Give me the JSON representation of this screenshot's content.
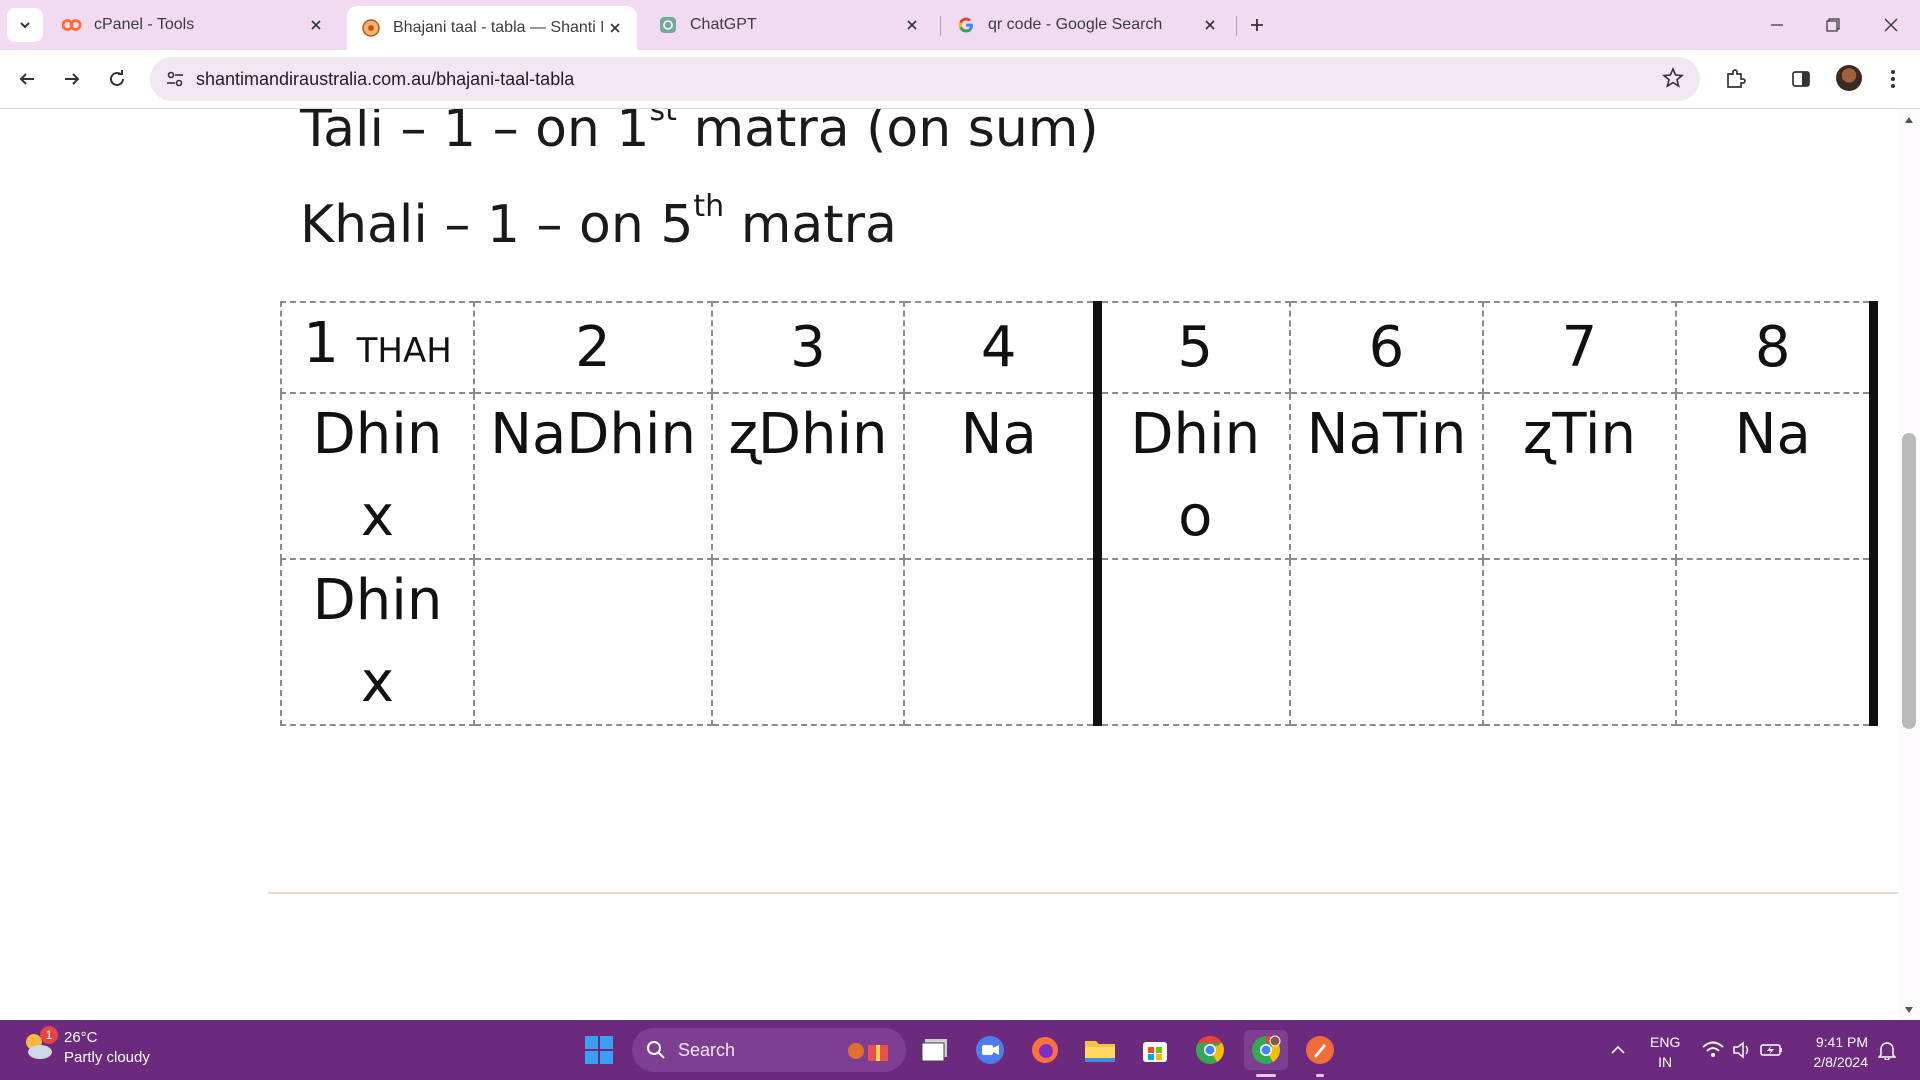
{
  "browser": {
    "tabs": [
      {
        "title": "cPanel - Tools",
        "active": false
      },
      {
        "title": "Bhajani taal - tabla — Shanti M",
        "active": true
      },
      {
        "title": "ChatGPT",
        "active": false
      },
      {
        "title": "qr code - Google Search",
        "active": false
      }
    ],
    "url": "shantimandiraustralia.com.au/bhajani-taal-tabla"
  },
  "page": {
    "tali_line": {
      "text": "Tali – 1 – on 1",
      "sup": "st",
      "rest": " matra (on sum)"
    },
    "khali_line": {
      "text": "Khali – 1 – on 5",
      "sup": "th",
      "rest": " matra"
    },
    "table": {
      "header": [
        {
          "num": "1",
          "extra": "THAH"
        },
        {
          "num": "2",
          "extra": ""
        },
        {
          "num": "3",
          "extra": ""
        },
        {
          "num": "4",
          "extra": ""
        },
        {
          "num": "5",
          "extra": ""
        },
        {
          "num": "6",
          "extra": ""
        },
        {
          "num": "7",
          "extra": ""
        },
        {
          "num": "8",
          "extra": ""
        }
      ],
      "row1": [
        "Dhin\nx",
        "NaDhin",
        "ʐDhin",
        "Na",
        "Dhin\no",
        "NaTin",
        "ʐTin",
        "Na"
      ],
      "row2": [
        "Dhin\nx",
        "",
        "",
        "",
        "",
        "",
        "",
        ""
      ]
    }
  },
  "taskbar": {
    "weather_temp": "26°C",
    "weather_desc": "Partly cloudy",
    "weather_badge": "1",
    "search_label": "Search",
    "lang_line1": "ENG",
    "lang_line2": "IN",
    "time": "9:41 PM",
    "date": "2/8/2024"
  },
  "colors": {
    "tabstrip": "#f2dbf1",
    "omnibox": "#f1e7f1",
    "taskbar": "#6b2a7e"
  }
}
